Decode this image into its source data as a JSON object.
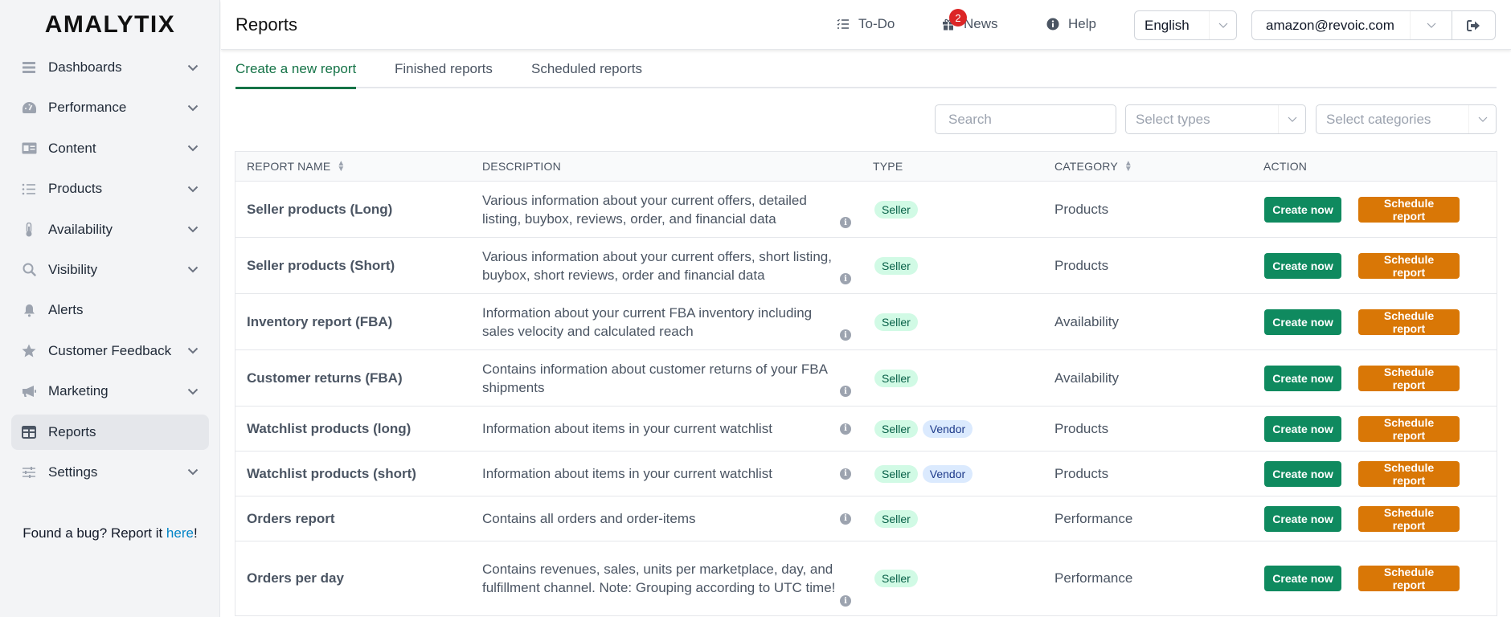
{
  "app": {
    "logo": "AMALYTIX",
    "page_title": "Reports"
  },
  "sidebar": {
    "items": [
      {
        "label": "Dashboards",
        "icon": "dashboard-icon",
        "has_chevron": true,
        "active": false
      },
      {
        "label": "Performance",
        "icon": "gauge-icon",
        "has_chevron": true,
        "active": false
      },
      {
        "label": "Content",
        "icon": "id-card-icon",
        "has_chevron": true,
        "active": false
      },
      {
        "label": "Products",
        "icon": "list-icon",
        "has_chevron": true,
        "active": false
      },
      {
        "label": "Availability",
        "icon": "thermometer-icon",
        "has_chevron": true,
        "active": false
      },
      {
        "label": "Visibility",
        "icon": "search-icon",
        "has_chevron": true,
        "active": false
      },
      {
        "label": "Alerts",
        "icon": "bell-icon",
        "has_chevron": false,
        "active": false
      },
      {
        "label": "Customer Feedback",
        "icon": "star-icon",
        "has_chevron": true,
        "active": false
      },
      {
        "label": "Marketing",
        "icon": "megaphone-icon",
        "has_chevron": true,
        "active": false
      },
      {
        "label": "Reports",
        "icon": "table-icon",
        "has_chevron": false,
        "active": true
      },
      {
        "label": "Settings",
        "icon": "sliders-icon",
        "has_chevron": true,
        "active": false
      }
    ],
    "bug_note": {
      "prefix": "Found a bug? Report it ",
      "link": "here",
      "suffix": "!"
    }
  },
  "header": {
    "todo": "To-Do",
    "news": "News",
    "news_badge": "2",
    "help": "Help",
    "language": "English",
    "user_email": "amazon@revoic.com"
  },
  "tabs": [
    {
      "label": "Create a new report",
      "active": true
    },
    {
      "label": "Finished reports",
      "active": false
    },
    {
      "label": "Scheduled reports",
      "active": false
    }
  ],
  "filters": {
    "search_placeholder": "Search",
    "types_placeholder": "Select types",
    "categories_placeholder": "Select categories"
  },
  "table": {
    "columns": {
      "name": "REPORT NAME",
      "description": "DESCRIPTION",
      "type": "TYPE",
      "category": "CATEGORY",
      "action": "ACTION"
    },
    "create_label": "Create now",
    "schedule_label": "Schedule report",
    "rows": [
      {
        "name": "Seller products (Long)",
        "description": "Various information about your current offers, detailed listing, buybox, reviews, order, and financial data",
        "types": [
          "Seller"
        ],
        "category": "Products"
      },
      {
        "name": "Seller products (Short)",
        "description": "Various information about your current offers, short listing, buybox, short reviews, order and financial data",
        "types": [
          "Seller"
        ],
        "category": "Products"
      },
      {
        "name": "Inventory report (FBA)",
        "description": "Information about your current FBA inventory including sales velocity and calculated reach",
        "types": [
          "Seller"
        ],
        "category": "Availability"
      },
      {
        "name": "Customer returns (FBA)",
        "description": "Contains information about customer returns of your FBA shipments",
        "types": [
          "Seller"
        ],
        "category": "Availability"
      },
      {
        "name": "Watchlist products (long)",
        "description": "Information about items in your current watchlist",
        "types": [
          "Seller",
          "Vendor"
        ],
        "category": "Products"
      },
      {
        "name": "Watchlist products (short)",
        "description": "Information about items in your current watchlist",
        "types": [
          "Seller",
          "Vendor"
        ],
        "category": "Products"
      },
      {
        "name": "Orders report",
        "description": "Contains all orders and order-items",
        "types": [
          "Seller"
        ],
        "category": "Performance"
      },
      {
        "name": "Orders per day",
        "description": "Contains revenues, sales, units per marketplace, day, and fulfillment channel. Note: Grouping according to UTC time!",
        "types": [
          "Seller"
        ],
        "category": "Performance"
      }
    ]
  },
  "colors": {
    "primary_green": "#0f8a5f",
    "schedule_orange": "#d97706",
    "badge_red": "#dc2626",
    "link_blue": "#0284c7"
  }
}
